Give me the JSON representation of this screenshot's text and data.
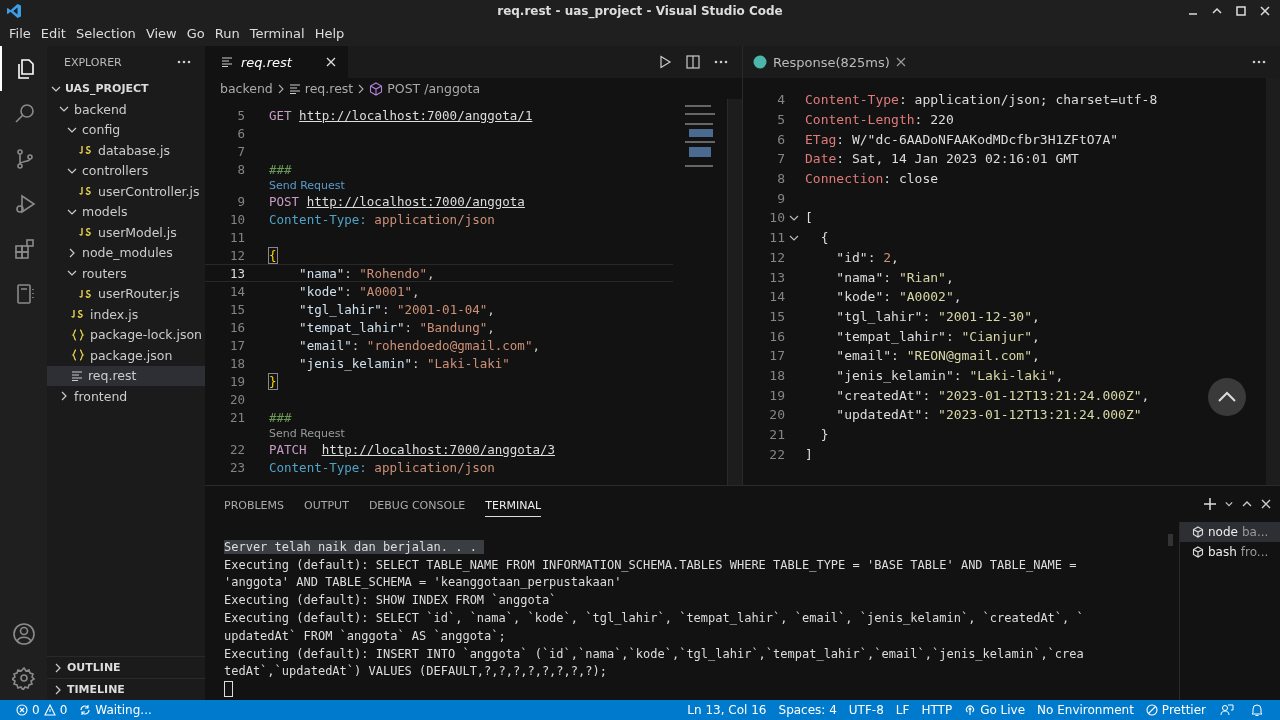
{
  "window": {
    "title": "req.rest - uas_project - Visual Studio Code"
  },
  "menu": [
    "File",
    "Edit",
    "Selection",
    "View",
    "Go",
    "Run",
    "Terminal",
    "Help"
  ],
  "activity_bar": [
    {
      "selected": true
    },
    {
      "selected": false
    },
    {
      "selected": false
    },
    {
      "selected": false
    },
    {
      "selected": false
    },
    {
      "selected": false
    }
  ],
  "sidebar": {
    "title": "EXPLORER",
    "project": "UAS_PROJECT",
    "tree": [
      {
        "label": "backend",
        "kind": "folder",
        "expanded": true,
        "selected": false,
        "children": [
          {
            "label": "config",
            "kind": "folder",
            "expanded": true,
            "selected": false,
            "children": [
              {
                "label": "database.js",
                "kind": "js",
                "selected": false
              }
            ]
          },
          {
            "label": "controllers",
            "kind": "folder",
            "expanded": true,
            "selected": false,
            "children": [
              {
                "label": "userController.js",
                "kind": "js",
                "selected": false
              }
            ]
          },
          {
            "label": "models",
            "kind": "folder",
            "expanded": true,
            "selected": false,
            "children": [
              {
                "label": "userModel.js",
                "kind": "js",
                "selected": false
              }
            ]
          },
          {
            "label": "node_modules",
            "kind": "folder",
            "expanded": false,
            "selected": false
          },
          {
            "label": "routers",
            "kind": "folder",
            "expanded": true,
            "selected": false,
            "children": [
              {
                "label": "userRouter.js",
                "kind": "js",
                "selected": false
              }
            ]
          },
          {
            "label": "index.js",
            "kind": "js",
            "selected": false
          },
          {
            "label": "package-lock.json",
            "kind": "json",
            "selected": false
          },
          {
            "label": "package.json",
            "kind": "json",
            "selected": false
          },
          {
            "label": "req.rest",
            "kind": "rest",
            "selected": true
          }
        ]
      },
      {
        "label": "frontend",
        "kind": "folder",
        "expanded": false,
        "selected": false
      }
    ],
    "sections": [
      "OUTLINE",
      "TIMELINE"
    ]
  },
  "editor": {
    "tab": "req.rest",
    "breadcrumbs": [
      "backend",
      "req.rest",
      "POST /anggota"
    ],
    "lines": [
      {
        "kind": "code",
        "number": "5",
        "current": false,
        "tokens": [
          {
            "kind": "method",
            "text": "GET "
          },
          {
            "kind": "url",
            "text": "http://localhost:7000/anggota/1"
          }
        ]
      },
      {
        "kind": "code",
        "number": "6",
        "current": false
      },
      {
        "kind": "code",
        "number": "7",
        "current": false
      },
      {
        "kind": "code",
        "number": "8",
        "current": false,
        "tokens": [
          {
            "kind": "comment",
            "text": "###"
          }
        ]
      },
      {
        "kind": "lens",
        "text": "Send Request",
        "hovered": true
      },
      {
        "kind": "code",
        "number": "9",
        "current": false,
        "tokens": [
          {
            "kind": "method",
            "text": "POST "
          },
          {
            "kind": "url",
            "text": "http://localhost:7000/anggota"
          }
        ]
      },
      {
        "kind": "code",
        "number": "10",
        "current": false,
        "tokens": [
          {
            "kind": "header",
            "text": "Content-Type: "
          },
          {
            "kind": "value",
            "text": "application/json"
          }
        ]
      },
      {
        "kind": "code",
        "number": "11",
        "current": false
      },
      {
        "kind": "code",
        "number": "12",
        "current": false,
        "tokens": [
          {
            "kind": "bracket",
            "text": "{"
          }
        ]
      },
      {
        "kind": "code",
        "number": "13",
        "current": true,
        "tokens": [
          {
            "kind": "key",
            "text": "    \"nama\""
          },
          {
            "kind": "punct",
            "text": ": "
          },
          {
            "kind": "string",
            "text": "\"Rohendo\""
          },
          {
            "kind": "punct",
            "text": ","
          }
        ]
      },
      {
        "kind": "code",
        "number": "14",
        "current": false,
        "tokens": [
          {
            "kind": "key",
            "text": "    \"kode\""
          },
          {
            "kind": "punct",
            "text": ": "
          },
          {
            "kind": "string",
            "text": "\"A0001\""
          },
          {
            "kind": "punct",
            "text": ","
          }
        ]
      },
      {
        "kind": "code",
        "number": "15",
        "current": false,
        "tokens": [
          {
            "kind": "key",
            "text": "    \"tgl_lahir\""
          },
          {
            "kind": "punct",
            "text": ": "
          },
          {
            "kind": "string",
            "text": "\"2001-01-04\""
          },
          {
            "kind": "punct",
            "text": ","
          }
        ]
      },
      {
        "kind": "code",
        "number": "16",
        "current": false,
        "tokens": [
          {
            "kind": "key",
            "text": "    \"tempat_lahir\""
          },
          {
            "kind": "punct",
            "text": ": "
          },
          {
            "kind": "string",
            "text": "\"Bandung\""
          },
          {
            "kind": "punct",
            "text": ","
          }
        ]
      },
      {
        "kind": "code",
        "number": "17",
        "current": false,
        "tokens": [
          {
            "kind": "key",
            "text": "    \"email\""
          },
          {
            "kind": "punct",
            "text": ": "
          },
          {
            "kind": "string",
            "text": "\"rohendoedo@gmail.com\""
          },
          {
            "kind": "punct",
            "text": ","
          }
        ]
      },
      {
        "kind": "code",
        "number": "18",
        "current": false,
        "tokens": [
          {
            "kind": "key",
            "text": "    \"jenis_kelamin\""
          },
          {
            "kind": "punct",
            "text": ": "
          },
          {
            "kind": "string",
            "text": "\"Laki-laki\""
          }
        ]
      },
      {
        "kind": "code",
        "number": "19",
        "current": false,
        "tokens": [
          {
            "kind": "bracket",
            "text": "}"
          }
        ]
      },
      {
        "kind": "code",
        "number": "20",
        "current": false
      },
      {
        "kind": "code",
        "number": "21",
        "current": false,
        "tokens": [
          {
            "kind": "comment",
            "text": "###"
          }
        ]
      },
      {
        "kind": "lens",
        "text": "Send Request",
        "hovered": false
      },
      {
        "kind": "code",
        "number": "22",
        "current": false,
        "tokens": [
          {
            "kind": "method",
            "text": "PATCH  "
          },
          {
            "kind": "url",
            "text": "http://localhost:7000/anggota/3"
          }
        ]
      },
      {
        "kind": "code",
        "number": "23",
        "current": false,
        "tokens": [
          {
            "kind": "header",
            "text": "Content-Type: "
          },
          {
            "kind": "value",
            "text": "application/json"
          }
        ]
      }
    ]
  },
  "response": {
    "tab": "Response(825ms)",
    "lines": [
      {
        "number": "4",
        "foldable": false,
        "tokens": [
          {
            "kind": "header",
            "text": "Content-Type"
          },
          {
            "kind": "punct",
            "text": ": application/json; charset=utf-8"
          }
        ]
      },
      {
        "number": "5",
        "foldable": false,
        "tokens": [
          {
            "kind": "header",
            "text": "Content-Length"
          },
          {
            "kind": "punct",
            "text": ": 220"
          }
        ]
      },
      {
        "number": "6",
        "foldable": false,
        "tokens": [
          {
            "kind": "header",
            "text": "ETag"
          },
          {
            "kind": "punct",
            "text": ": W/\"dc-6AADoNFAAKodMDcfbr3H1ZFtO7A\""
          }
        ]
      },
      {
        "number": "7",
        "foldable": false,
        "tokens": [
          {
            "kind": "header",
            "text": "Date"
          },
          {
            "kind": "punct",
            "text": ": Sat, 14 Jan 2023 02:16:01 GMT"
          }
        ]
      },
      {
        "number": "8",
        "foldable": false,
        "tokens": [
          {
            "kind": "header",
            "text": "Connection"
          },
          {
            "kind": "punct",
            "text": ": close"
          }
        ]
      },
      {
        "number": "9",
        "foldable": false
      },
      {
        "number": "10",
        "foldable": true,
        "tokens": [
          {
            "kind": "punct",
            "text": "["
          }
        ]
      },
      {
        "number": "11",
        "foldable": true,
        "tokens": [
          {
            "kind": "punct",
            "text": "  {"
          }
        ]
      },
      {
        "number": "12",
        "foldable": false,
        "tokens": [
          {
            "kind": "key",
            "text": "    \"id\""
          },
          {
            "kind": "punct",
            "text": ": "
          },
          {
            "kind": "number",
            "text": "2"
          },
          {
            "kind": "punct",
            "text": ","
          }
        ]
      },
      {
        "number": "13",
        "foldable": false,
        "tokens": [
          {
            "kind": "key",
            "text": "    \"nama\""
          },
          {
            "kind": "punct",
            "text": ": "
          },
          {
            "kind": "string",
            "text": "\"Rian\""
          },
          {
            "kind": "punct",
            "text": ","
          }
        ]
      },
      {
        "number": "14",
        "foldable": false,
        "tokens": [
          {
            "kind": "key",
            "text": "    \"kode\""
          },
          {
            "kind": "punct",
            "text": ": "
          },
          {
            "kind": "string",
            "text": "\"A0002\""
          },
          {
            "kind": "punct",
            "text": ","
          }
        ]
      },
      {
        "number": "15",
        "foldable": false,
        "tokens": [
          {
            "kind": "key",
            "text": "    \"tgl_lahir\""
          },
          {
            "kind": "punct",
            "text": ": "
          },
          {
            "kind": "string",
            "text": "\"2001-12-30\""
          },
          {
            "kind": "punct",
            "text": ","
          }
        ]
      },
      {
        "number": "16",
        "foldable": false,
        "tokens": [
          {
            "kind": "key",
            "text": "    \"tempat_lahir\""
          },
          {
            "kind": "punct",
            "text": ": "
          },
          {
            "kind": "string",
            "text": "\"Cianjur\""
          },
          {
            "kind": "punct",
            "text": ","
          }
        ]
      },
      {
        "number": "17",
        "foldable": false,
        "tokens": [
          {
            "kind": "key",
            "text": "    \"email\""
          },
          {
            "kind": "punct",
            "text": ": "
          },
          {
            "kind": "string",
            "text": "\"REON@gmail.com\""
          },
          {
            "kind": "punct",
            "text": ","
          }
        ]
      },
      {
        "number": "18",
        "foldable": false,
        "tokens": [
          {
            "kind": "key",
            "text": "    \"jenis_kelamin\""
          },
          {
            "kind": "punct",
            "text": ": "
          },
          {
            "kind": "string",
            "text": "\"Laki-laki\""
          },
          {
            "kind": "punct",
            "text": ","
          }
        ]
      },
      {
        "number": "19",
        "foldable": false,
        "tokens": [
          {
            "kind": "key",
            "text": "    \"createdAt\""
          },
          {
            "kind": "punct",
            "text": ": "
          },
          {
            "kind": "string",
            "text": "\"2023-01-12T13:21:24.000Z\""
          },
          {
            "kind": "punct",
            "text": ","
          }
        ]
      },
      {
        "number": "20",
        "foldable": false,
        "tokens": [
          {
            "kind": "key",
            "text": "    \"updatedAt\""
          },
          {
            "kind": "punct",
            "text": ": "
          },
          {
            "kind": "string",
            "text": "\"2023-01-12T13:21:24.000Z\""
          }
        ]
      },
      {
        "number": "21",
        "foldable": false,
        "tokens": [
          {
            "kind": "punct",
            "text": "  }"
          }
        ]
      },
      {
        "number": "22",
        "foldable": false,
        "tokens": [
          {
            "kind": "punct",
            "text": "]"
          }
        ]
      }
    ]
  },
  "panel": {
    "tabs": [
      {
        "label": "PROBLEMS",
        "selected": false
      },
      {
        "label": "OUTPUT",
        "selected": false
      },
      {
        "label": "DEBUG CONSOLE",
        "selected": false
      },
      {
        "label": "TERMINAL",
        "selected": true
      }
    ],
    "terminal_lines": [
      {
        "text": "Server telah naik dan berjalan. . . ",
        "highlighted": true
      },
      {
        "text": "Executing (default): SELECT TABLE_NAME FROM INFORMATION_SCHEMA.TABLES WHERE TABLE_TYPE = 'BASE TABLE' AND TABLE_NAME =",
        "highlighted": false
      },
      {
        "text": "'anggota' AND TABLE_SCHEMA = 'keanggotaan_perpustakaan'",
        "highlighted": false
      },
      {
        "text": "Executing (default): SHOW INDEX FROM `anggota`",
        "highlighted": false
      },
      {
        "text": "Executing (default): SELECT `id`, `nama`, `kode`, `tgl_lahir`, `tempat_lahir`, `email`, `jenis_kelamin`, `createdAt`, `",
        "highlighted": false
      },
      {
        "text": "updatedAt` FROM `anggota` AS `anggota`;",
        "highlighted": false
      },
      {
        "text": "Executing (default): INSERT INTO `anggota` (`id`,`nama`,`kode`,`tgl_lahir`,`tempat_lahir`,`email`,`jenis_kelamin`,`crea",
        "highlighted": false
      },
      {
        "text": "tedAt`,`updatedAt`) VALUES (DEFAULT,?,?,?,?,?,?,?,?);",
        "highlighted": false
      }
    ],
    "terminals": [
      {
        "label": "node",
        "detail": "ba...",
        "selected": true
      },
      {
        "label": "bash",
        "detail": "fro...",
        "selected": false
      }
    ]
  },
  "status_bar": {
    "errors": "0",
    "warnings": "0",
    "task": "Waiting...",
    "right": [
      {
        "text": "Ln 13, Col 16",
        "kind": "plain"
      },
      {
        "text": "Spaces: 4",
        "kind": "plain"
      },
      {
        "text": "UTF-8",
        "kind": "plain"
      },
      {
        "text": "LF",
        "kind": "plain"
      },
      {
        "text": "HTTP",
        "kind": "plain"
      },
      {
        "text": "Go Live",
        "kind": "live"
      },
      {
        "text": "No Environment",
        "kind": "plain"
      },
      {
        "text": "Prettier",
        "kind": "formatter"
      }
    ]
  }
}
